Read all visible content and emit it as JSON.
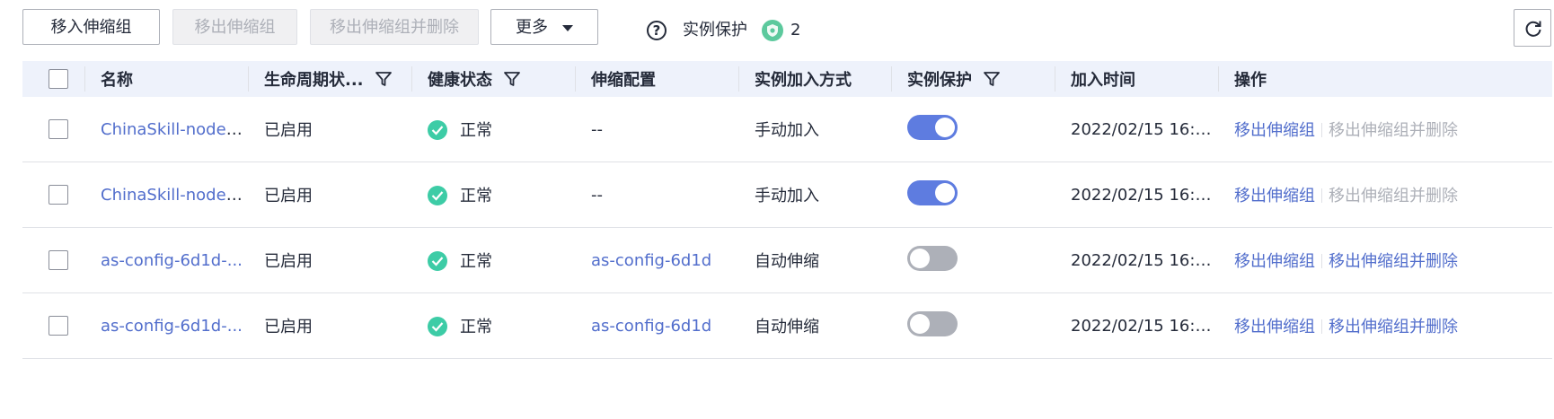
{
  "toolbar": {
    "move_in": "移入伸缩组",
    "move_out": "移出伸缩组",
    "move_out_delete": "移出伸缩组并删除",
    "more": "更多",
    "help_icon": "?",
    "protection_label": "实例保护",
    "protection_count": "2",
    "icons": {
      "help": "question-circle-icon",
      "shield": "shield-icon",
      "refresh": "refresh-icon"
    }
  },
  "table": {
    "headers": [
      "名称",
      "生命周期状...",
      "健康状态",
      "伸缩配置",
      "实例加入方式",
      "实例保护",
      "加入时间",
      "操作"
    ],
    "rows": [
      {
        "name": "ChinaSkill-node1...",
        "lifecycle": "已启用",
        "health": "正常",
        "config": "--",
        "config_link": false,
        "join_method": "手动加入",
        "protected": true,
        "join_time": "2022/02/15 16:1...",
        "op_move_out": "移出伸缩组",
        "op_move_out_delete": "移出伸缩组并删除",
        "delete_enabled": false
      },
      {
        "name": "ChinaSkill-node1...",
        "lifecycle": "已启用",
        "health": "正常",
        "config": "--",
        "config_link": false,
        "join_method": "手动加入",
        "protected": true,
        "join_time": "2022/02/15 16:1...",
        "op_move_out": "移出伸缩组",
        "op_move_out_delete": "移出伸缩组并删除",
        "delete_enabled": false
      },
      {
        "name": "as-config-6d1d-...",
        "lifecycle": "已启用",
        "health": "正常",
        "config": "as-config-6d1d",
        "config_link": true,
        "join_method": "自动伸缩",
        "protected": false,
        "join_time": "2022/02/15 16:0...",
        "op_move_out": "移出伸缩组",
        "op_move_out_delete": "移出伸缩组并删除",
        "delete_enabled": true
      },
      {
        "name": "as-config-6d1d-...",
        "lifecycle": "已启用",
        "health": "正常",
        "config": "as-config-6d1d",
        "config_link": true,
        "join_method": "自动伸缩",
        "protected": false,
        "join_time": "2022/02/15 16:0...",
        "op_move_out": "移出伸缩组",
        "op_move_out_delete": "移出伸缩组并删除",
        "delete_enabled": true
      }
    ]
  },
  "colors": {
    "link": "#526ecc",
    "toggle_on": "#5e7ce0",
    "toggle_off": "#adb0b8",
    "health_ok": "#3dcca6",
    "header_bg": "#eef2fb"
  }
}
